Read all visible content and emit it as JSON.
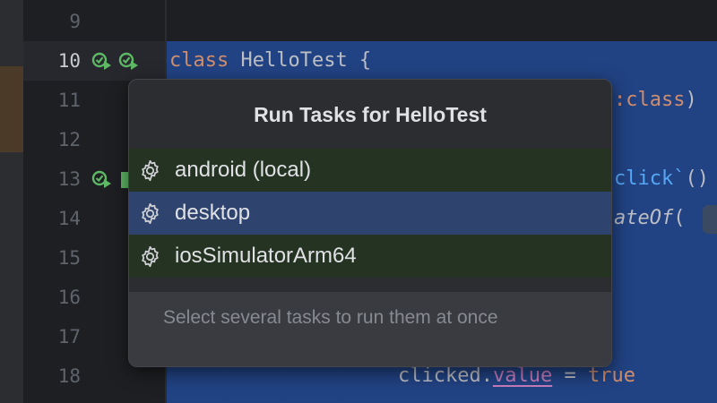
{
  "gutter": {
    "line_numbers": [
      "9",
      "10",
      "11",
      "12",
      "13",
      "14",
      "15",
      "16",
      "17",
      "18"
    ],
    "run_icons": [
      "run-test-icon",
      "run-all-icon"
    ]
  },
  "code": {
    "line10": {
      "keyword": "class",
      "name": " HelloTest {"
    },
    "line11": {
      "keyword": ":class",
      "suffix": ")"
    },
    "line13": {
      "fn": "click`",
      "suffix": "()"
    },
    "line14": {
      "italic": "ateOf",
      "suffix": "( "
    },
    "line18": {
      "obj": "clicked.",
      "prop": "value",
      "op": " = ",
      "literal": "true"
    }
  },
  "popup": {
    "title": "Run Tasks for HelloTest",
    "tasks": [
      {
        "label": "android (local)",
        "icon": "gear-icon"
      },
      {
        "label": "desktop",
        "icon": "gear-icon"
      },
      {
        "label": "iosSimulatorArm64",
        "icon": "gear-icon"
      }
    ],
    "selected_task": "desktop",
    "hint": "Select several tasks to run them at once"
  },
  "colors": {
    "editor_bg": "#1e1f22",
    "selection": "#214283",
    "popup_bg": "#2b2d30",
    "task_bg": "#253322",
    "task_selected_bg": "#2e436e",
    "run_icon": "#5fb865"
  }
}
